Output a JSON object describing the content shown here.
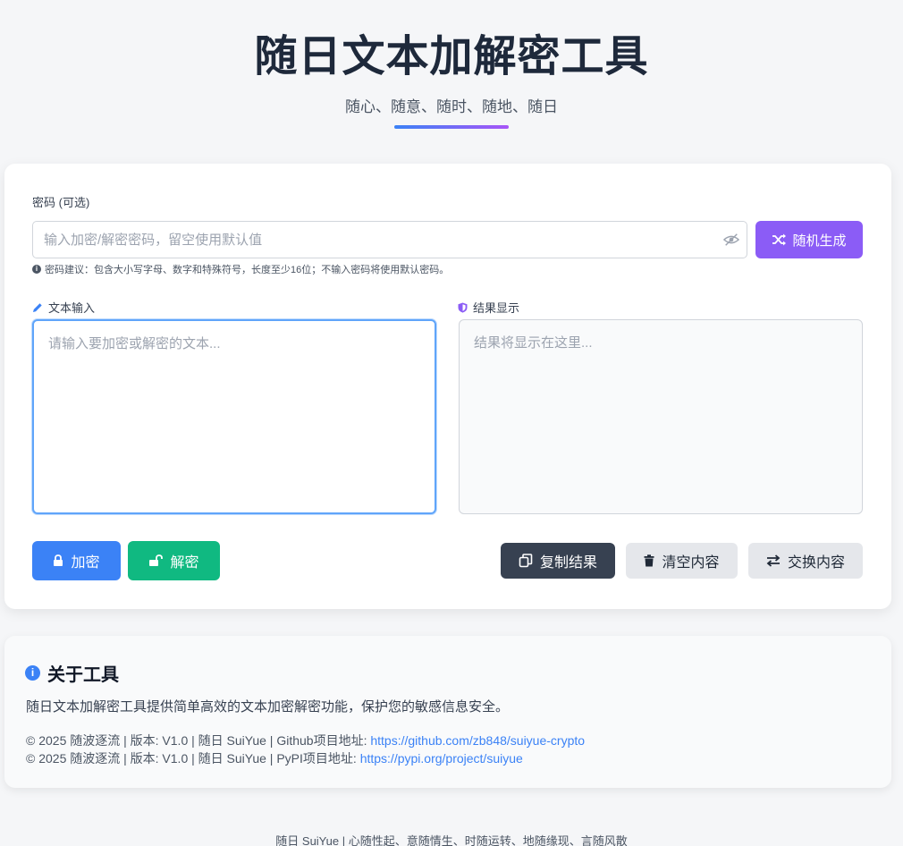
{
  "header": {
    "title": "随日文本加解密工具",
    "subtitle": "随心、随意、随时、随地、随日"
  },
  "password": {
    "label": "密码 (可选)",
    "placeholder": "输入加密/解密密码，留空使用默认值",
    "value": "",
    "random_button": "随机生成",
    "hint": "密码建议：包含大小写字母、数字和特殊符号，长度至少16位；不输入密码将使用默认密码。"
  },
  "input": {
    "label": "文本输入",
    "placeholder": "请输入要加密或解密的文本..."
  },
  "result": {
    "label": "结果显示",
    "placeholder": "结果将显示在这里..."
  },
  "actions": {
    "encrypt": "加密",
    "decrypt": "解密",
    "copy": "复制结果",
    "clear": "清空内容",
    "swap": "交换内容"
  },
  "about": {
    "title": "关于工具",
    "description": "随日文本加解密工具提供简单高效的文本加密解密功能，保护您的敏感信息安全。",
    "github_prefix": "© 2025 随波逐流 | 版本: V1.0 | 随日 SuiYue | Github项目地址: ",
    "github_url": "https://github.com/zb848/suiyue-crypto",
    "pypi_prefix": "© 2025 随波逐流 | 版本: V1.0 | 随日 SuiYue | PyPI项目地址: ",
    "pypi_url": "https://pypi.org/project/suiyue"
  },
  "footer": {
    "text": "随日 SuiYue | 心随性起、意随情生、时随运转、地随缘现、言随风散"
  },
  "colors": {
    "primary": "#3b82f6",
    "purple": "#8b5cf6",
    "green": "#10b981",
    "dark": "#374151"
  },
  "icons": {
    "random": "shuffle-icon",
    "eye": "eye-slash-icon",
    "input": "pencil-icon",
    "result": "shield-icon",
    "encrypt": "lock-icon",
    "decrypt": "unlock-icon",
    "copy": "copy-icon",
    "clear": "trash-icon",
    "swap": "swap-icon",
    "about": "info-icon"
  }
}
